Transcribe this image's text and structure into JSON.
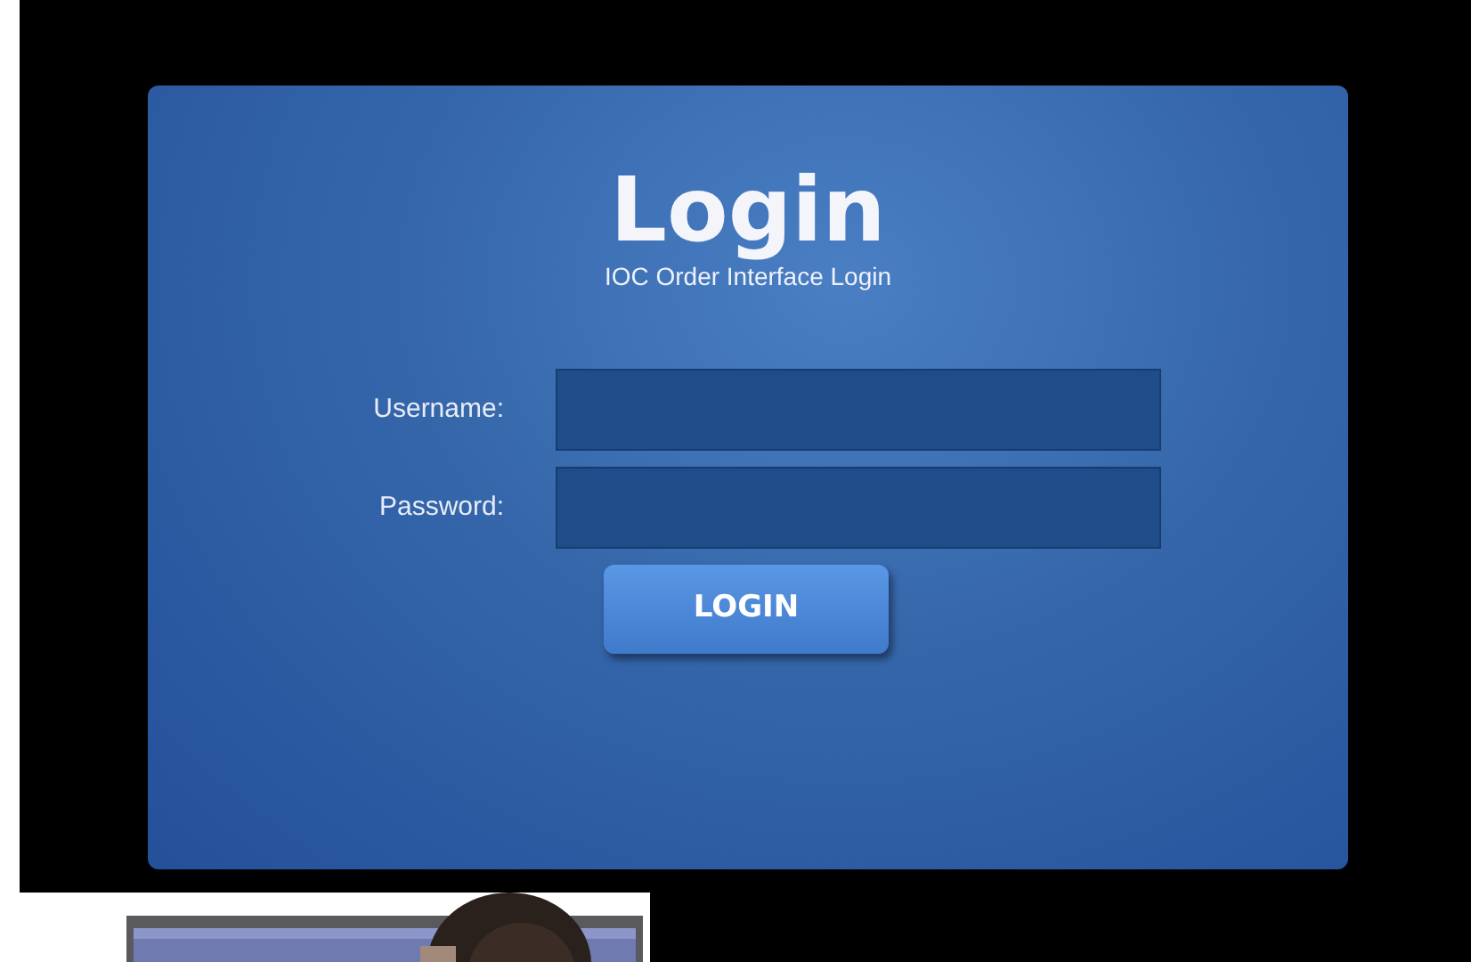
{
  "login": {
    "title": "Login",
    "subtitle": "IOC Order Interface Login",
    "fields": [
      {
        "label": "Username:"
      },
      {
        "label": "Password:"
      }
    ],
    "button": "LOGIN"
  }
}
